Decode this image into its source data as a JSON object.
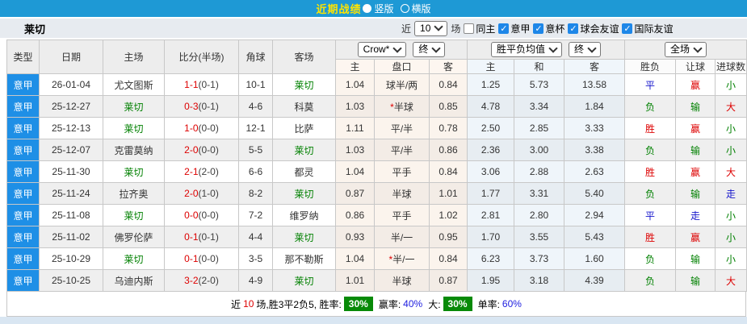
{
  "topbar": {
    "title": "近期战绩",
    "view_options": [
      {
        "label": "竖版",
        "selected": true
      },
      {
        "label": "横版",
        "selected": false
      }
    ]
  },
  "team_bar": {
    "team": "莱切",
    "near_label": "近",
    "match_count": "10",
    "count_suffix": "场",
    "filters": [
      {
        "label": "同主",
        "checked": false
      },
      {
        "label": "意甲",
        "checked": true
      },
      {
        "label": "意杯",
        "checked": true
      },
      {
        "label": "球会友谊",
        "checked": true
      },
      {
        "label": "国际友谊",
        "checked": true
      }
    ]
  },
  "controls": {
    "odds_source": "Crow*",
    "odds_time": "终",
    "avg_label": "胜平负均值",
    "avg_time": "终",
    "scope": "全场"
  },
  "table": {
    "col_headers": [
      "类型",
      "日期",
      "主场",
      "比分(半场)",
      "角球",
      "客场"
    ],
    "sub_headers": [
      "主",
      "盘口",
      "客",
      "主",
      "和",
      "客",
      "胜负",
      "让球",
      "进球数"
    ],
    "rows": [
      {
        "type": "意甲",
        "date": "26-01-04",
        "home": "尤文图斯",
        "ft": "1-1",
        "ht": "0-1",
        "corner": "10-1",
        "away": "莱切",
        "ah_home": "1.04",
        "ah_line": "球半/两",
        "ah_away": "0.84",
        "sp_home": "1.25",
        "sp_draw": "5.73",
        "sp_away": "13.58",
        "wdl": "平",
        "ah_res": "赢",
        "ou": "小"
      },
      {
        "type": "意甲",
        "date": "25-12-27",
        "home": "莱切",
        "ft": "0-3",
        "ht": "0-1",
        "corner": "4-6",
        "away": "科莫",
        "ah_home": "1.03",
        "ah_line": "*半球",
        "ah_away": "0.85",
        "sp_home": "4.78",
        "sp_draw": "3.34",
        "sp_away": "1.84",
        "wdl": "负",
        "ah_res": "输",
        "ou": "大"
      },
      {
        "type": "意甲",
        "date": "25-12-13",
        "home": "莱切",
        "ft": "1-0",
        "ht": "0-0",
        "corner": "12-1",
        "away": "比萨",
        "ah_home": "1.11",
        "ah_line": "平/半",
        "ah_away": "0.78",
        "sp_home": "2.50",
        "sp_draw": "2.85",
        "sp_away": "3.33",
        "wdl": "胜",
        "ah_res": "赢",
        "ou": "小"
      },
      {
        "type": "意甲",
        "date": "25-12-07",
        "home": "克雷莫纳",
        "ft": "2-0",
        "ht": "0-0",
        "corner": "5-5",
        "away": "莱切",
        "ah_home": "1.03",
        "ah_line": "平/半",
        "ah_away": "0.86",
        "sp_home": "2.36",
        "sp_draw": "3.00",
        "sp_away": "3.38",
        "wdl": "负",
        "ah_res": "输",
        "ou": "小"
      },
      {
        "type": "意甲",
        "date": "25-11-30",
        "home": "莱切",
        "ft": "2-1",
        "ht": "2-0",
        "corner": "6-6",
        "away": "都灵",
        "ah_home": "1.04",
        "ah_line": "平手",
        "ah_away": "0.84",
        "sp_home": "3.06",
        "sp_draw": "2.88",
        "sp_away": "2.63",
        "wdl": "胜",
        "ah_res": "赢",
        "ou": "大"
      },
      {
        "type": "意甲",
        "date": "25-11-24",
        "home": "拉齐奥",
        "ft": "2-0",
        "ht": "1-0",
        "corner": "8-2",
        "away": "莱切",
        "ah_home": "0.87",
        "ah_line": "半球",
        "ah_away": "1.01",
        "sp_home": "1.77",
        "sp_draw": "3.31",
        "sp_away": "5.40",
        "wdl": "负",
        "ah_res": "输",
        "ou": "走"
      },
      {
        "type": "意甲",
        "date": "25-11-08",
        "home": "莱切",
        "ft": "0-0",
        "ht": "0-0",
        "corner": "7-2",
        "away": "维罗纳",
        "ah_home": "0.86",
        "ah_line": "平手",
        "ah_away": "1.02",
        "sp_home": "2.81",
        "sp_draw": "2.80",
        "sp_away": "2.94",
        "wdl": "平",
        "ah_res": "走",
        "ou": "小"
      },
      {
        "type": "意甲",
        "date": "25-11-02",
        "home": "佛罗伦萨",
        "ft": "0-1",
        "ht": "0-1",
        "corner": "4-4",
        "away": "莱切",
        "ah_home": "0.93",
        "ah_line": "半/一",
        "ah_away": "0.95",
        "sp_home": "1.70",
        "sp_draw": "3.55",
        "sp_away": "5.43",
        "wdl": "胜",
        "ah_res": "赢",
        "ou": "小"
      },
      {
        "type": "意甲",
        "date": "25-10-29",
        "home": "莱切",
        "ft": "0-1",
        "ht": "0-0",
        "corner": "3-5",
        "away": "那不勒斯",
        "ah_home": "1.04",
        "ah_line": "*半/一",
        "ah_away": "0.84",
        "sp_home": "6.23",
        "sp_draw": "3.73",
        "sp_away": "1.60",
        "wdl": "负",
        "ah_res": "输",
        "ou": "小"
      },
      {
        "type": "意甲",
        "date": "25-10-25",
        "home": "乌迪内斯",
        "ft": "3-2",
        "ht": "2-0",
        "corner": "4-9",
        "away": "莱切",
        "ah_home": "1.01",
        "ah_line": "半球",
        "ah_away": "0.87",
        "sp_home": "1.95",
        "sp_draw": "3.18",
        "sp_away": "4.39",
        "wdl": "负",
        "ah_res": "输",
        "ou": "大"
      }
    ]
  },
  "summary": {
    "prefix": "近",
    "count": "10",
    "mid": "场,胜3平2负5, 胜率:",
    "win_rate_badge": "30%",
    "win_odds_label": "赢率:",
    "win_odds": "40%",
    "big_label": "大:",
    "big_badge": "30%",
    "single_label": "单率:",
    "single_rate": "60%"
  },
  "colors": {
    "topbar_blue": "#1E99D5",
    "title_yellow": "#FFE400",
    "league_cell_blue": "#1E8FE6",
    "win_red": "#DD0000",
    "lose_green": "#008000",
    "draw_blue": "#1515CC",
    "badge_green": "#088A08",
    "handicap_tint": "#FBF4ED",
    "odds_tint": "#EFF5FA"
  }
}
